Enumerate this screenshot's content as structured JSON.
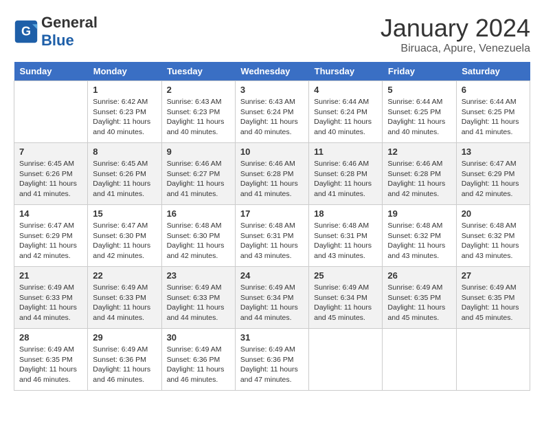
{
  "header": {
    "logo_general": "General",
    "logo_blue": "Blue",
    "month_title": "January 2024",
    "location": "Biruaca, Apure, Venezuela"
  },
  "columns": [
    "Sunday",
    "Monday",
    "Tuesday",
    "Wednesday",
    "Thursday",
    "Friday",
    "Saturday"
  ],
  "weeks": [
    [
      {
        "day": "",
        "detail": ""
      },
      {
        "day": "1",
        "detail": "Sunrise: 6:42 AM\nSunset: 6:23 PM\nDaylight: 11 hours\nand 40 minutes."
      },
      {
        "day": "2",
        "detail": "Sunrise: 6:43 AM\nSunset: 6:23 PM\nDaylight: 11 hours\nand 40 minutes."
      },
      {
        "day": "3",
        "detail": "Sunrise: 6:43 AM\nSunset: 6:24 PM\nDaylight: 11 hours\nand 40 minutes."
      },
      {
        "day": "4",
        "detail": "Sunrise: 6:44 AM\nSunset: 6:24 PM\nDaylight: 11 hours\nand 40 minutes."
      },
      {
        "day": "5",
        "detail": "Sunrise: 6:44 AM\nSunset: 6:25 PM\nDaylight: 11 hours\nand 40 minutes."
      },
      {
        "day": "6",
        "detail": "Sunrise: 6:44 AM\nSunset: 6:25 PM\nDaylight: 11 hours\nand 41 minutes."
      }
    ],
    [
      {
        "day": "7",
        "detail": "Sunrise: 6:45 AM\nSunset: 6:26 PM\nDaylight: 11 hours\nand 41 minutes."
      },
      {
        "day": "8",
        "detail": "Sunrise: 6:45 AM\nSunset: 6:26 PM\nDaylight: 11 hours\nand 41 minutes."
      },
      {
        "day": "9",
        "detail": "Sunrise: 6:46 AM\nSunset: 6:27 PM\nDaylight: 11 hours\nand 41 minutes."
      },
      {
        "day": "10",
        "detail": "Sunrise: 6:46 AM\nSunset: 6:28 PM\nDaylight: 11 hours\nand 41 minutes."
      },
      {
        "day": "11",
        "detail": "Sunrise: 6:46 AM\nSunset: 6:28 PM\nDaylight: 11 hours\nand 41 minutes."
      },
      {
        "day": "12",
        "detail": "Sunrise: 6:46 AM\nSunset: 6:28 PM\nDaylight: 11 hours\nand 42 minutes."
      },
      {
        "day": "13",
        "detail": "Sunrise: 6:47 AM\nSunset: 6:29 PM\nDaylight: 11 hours\nand 42 minutes."
      }
    ],
    [
      {
        "day": "14",
        "detail": "Sunrise: 6:47 AM\nSunset: 6:29 PM\nDaylight: 11 hours\nand 42 minutes."
      },
      {
        "day": "15",
        "detail": "Sunrise: 6:47 AM\nSunset: 6:30 PM\nDaylight: 11 hours\nand 42 minutes."
      },
      {
        "day": "16",
        "detail": "Sunrise: 6:48 AM\nSunset: 6:30 PM\nDaylight: 11 hours\nand 42 minutes."
      },
      {
        "day": "17",
        "detail": "Sunrise: 6:48 AM\nSunset: 6:31 PM\nDaylight: 11 hours\nand 43 minutes."
      },
      {
        "day": "18",
        "detail": "Sunrise: 6:48 AM\nSunset: 6:31 PM\nDaylight: 11 hours\nand 43 minutes."
      },
      {
        "day": "19",
        "detail": "Sunrise: 6:48 AM\nSunset: 6:32 PM\nDaylight: 11 hours\nand 43 minutes."
      },
      {
        "day": "20",
        "detail": "Sunrise: 6:48 AM\nSunset: 6:32 PM\nDaylight: 11 hours\nand 43 minutes."
      }
    ],
    [
      {
        "day": "21",
        "detail": "Sunrise: 6:49 AM\nSunset: 6:33 PM\nDaylight: 11 hours\nand 44 minutes."
      },
      {
        "day": "22",
        "detail": "Sunrise: 6:49 AM\nSunset: 6:33 PM\nDaylight: 11 hours\nand 44 minutes."
      },
      {
        "day": "23",
        "detail": "Sunrise: 6:49 AM\nSunset: 6:33 PM\nDaylight: 11 hours\nand 44 minutes."
      },
      {
        "day": "24",
        "detail": "Sunrise: 6:49 AM\nSunset: 6:34 PM\nDaylight: 11 hours\nand 44 minutes."
      },
      {
        "day": "25",
        "detail": "Sunrise: 6:49 AM\nSunset: 6:34 PM\nDaylight: 11 hours\nand 45 minutes."
      },
      {
        "day": "26",
        "detail": "Sunrise: 6:49 AM\nSunset: 6:35 PM\nDaylight: 11 hours\nand 45 minutes."
      },
      {
        "day": "27",
        "detail": "Sunrise: 6:49 AM\nSunset: 6:35 PM\nDaylight: 11 hours\nand 45 minutes."
      }
    ],
    [
      {
        "day": "28",
        "detail": "Sunrise: 6:49 AM\nSunset: 6:35 PM\nDaylight: 11 hours\nand 46 minutes."
      },
      {
        "day": "29",
        "detail": "Sunrise: 6:49 AM\nSunset: 6:36 PM\nDaylight: 11 hours\nand 46 minutes."
      },
      {
        "day": "30",
        "detail": "Sunrise: 6:49 AM\nSunset: 6:36 PM\nDaylight: 11 hours\nand 46 minutes."
      },
      {
        "day": "31",
        "detail": "Sunrise: 6:49 AM\nSunset: 6:36 PM\nDaylight: 11 hours\nand 47 minutes."
      },
      {
        "day": "",
        "detail": ""
      },
      {
        "day": "",
        "detail": ""
      },
      {
        "day": "",
        "detail": ""
      }
    ]
  ]
}
